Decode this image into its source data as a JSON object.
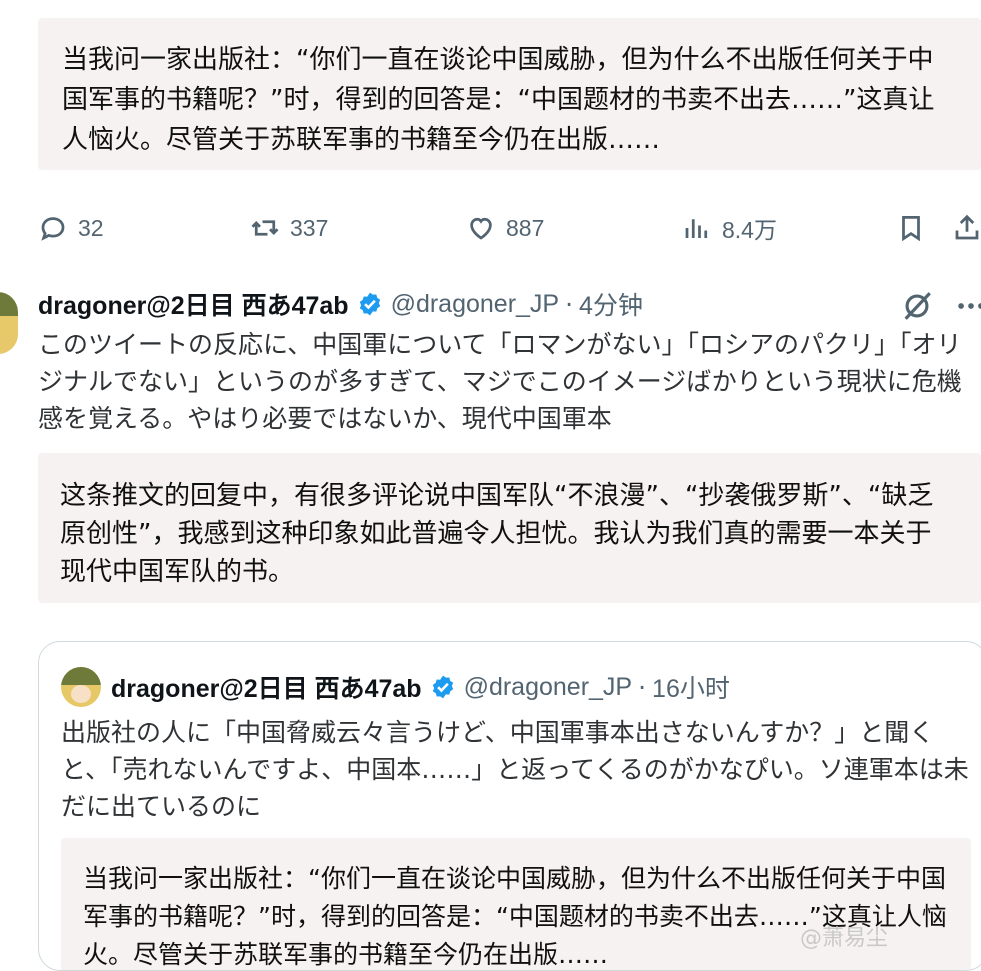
{
  "top_translation": "当我问一家出版社：“你们一直在谈论中国威胁，但为什么不出版任何关于中国军事的书籍呢？”时，得到的回答是：“中国题材的书卖不出去……”这真让人恼火。尽管关于苏联军事的书籍至今仍在出版……",
  "actions": {
    "reply_count": "32",
    "retweet_count": "337",
    "like_count": "887",
    "view_count": "8.4万"
  },
  "tweet": {
    "name": "dragoner@2日目 西あ47ab",
    "handle": "@dragoner_JP",
    "separator": "·",
    "time": "4分钟",
    "text": "このツイートの反応に、中国軍について「ロマンがない」「ロシアのパクリ」「オリジナルでない」というのが多すぎて、マジでこのイメージばかりという現状に危機感を覚える。やはり必要ではないか、現代中国軍本",
    "translation": "这条推文的回复中，有很多评论说中国军队“不浪漫”、“抄袭俄罗斯”、“缺乏原创性”，我感到这种印象如此普遍令人担忧。我认为我们真的需要一本关于现代中国军队的书。"
  },
  "quoted": {
    "name": "dragoner@2日目 西あ47ab",
    "handle": "@dragoner_JP",
    "separator": "·",
    "time": "16小时",
    "text": "出版社の人に「中国脅威云々言うけど、中国軍事本出さないんすか？」と聞くと、「売れないんですよ、中国本……」と返ってくるのがかなぴい。ソ連軍本は未だに出ているのに",
    "translation": "当我问一家出版社：“你们一直在谈论中国威胁，但为什么不出版任何关于中国军事的书籍呢？”时，得到的回答是：“中国题材的书卖不出去……”这真让人恼火。尽管关于苏联军事的书籍至今仍在出版……"
  },
  "watermark": "@萧易尘"
}
